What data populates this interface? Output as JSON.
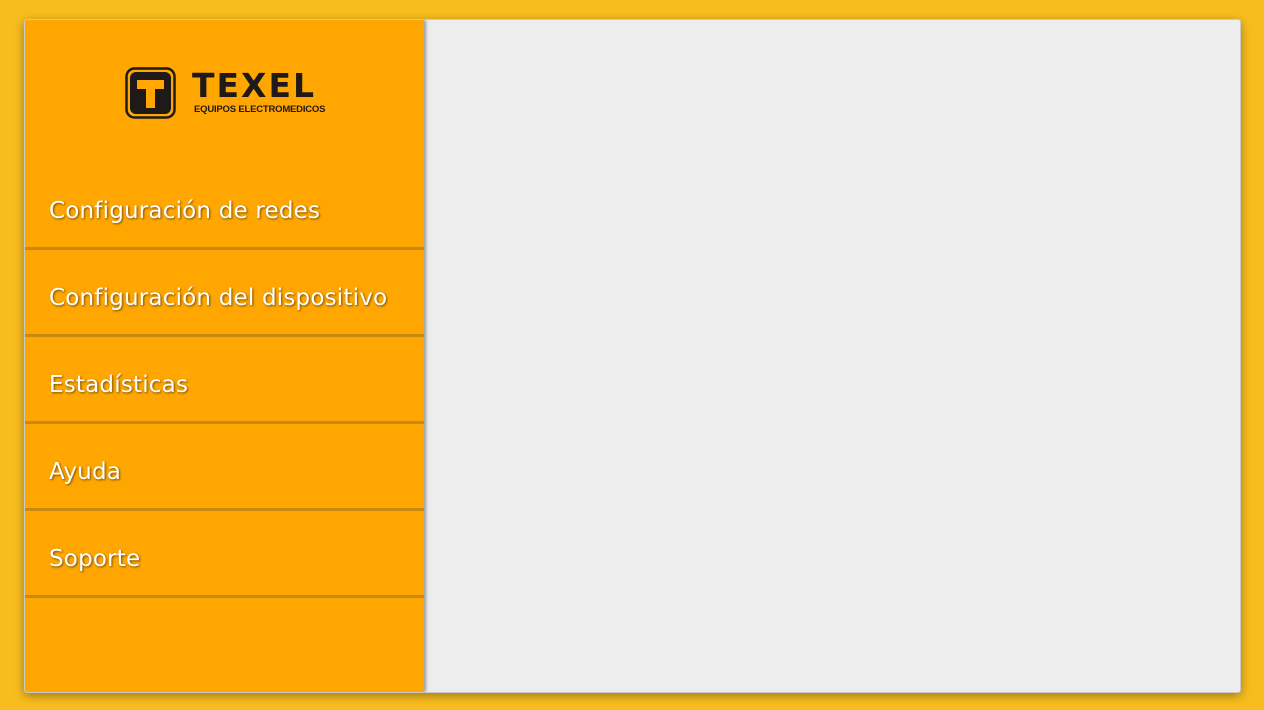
{
  "app": {
    "logo": {
      "brand_name": "TEXEL",
      "tagline": "EQUIPOS ELECTROMEDICOS",
      "icon": "texel-logo-icon"
    }
  },
  "sidebar": {
    "items": [
      {
        "label": "Configuración de redes",
        "id": "network-config"
      },
      {
        "label": "Configuración del dispositivo",
        "id": "device-config"
      },
      {
        "label": "Estadísticas",
        "id": "statistics"
      },
      {
        "label": "Ayuda",
        "id": "help"
      },
      {
        "label": "Soporte",
        "id": "support"
      }
    ]
  },
  "colors": {
    "background": "#f7bd1f",
    "sidebar": "#ffa600",
    "sidebar_divider": "#c98a10",
    "content_panel": "#ededed",
    "logo_dark": "#1f1a17"
  }
}
